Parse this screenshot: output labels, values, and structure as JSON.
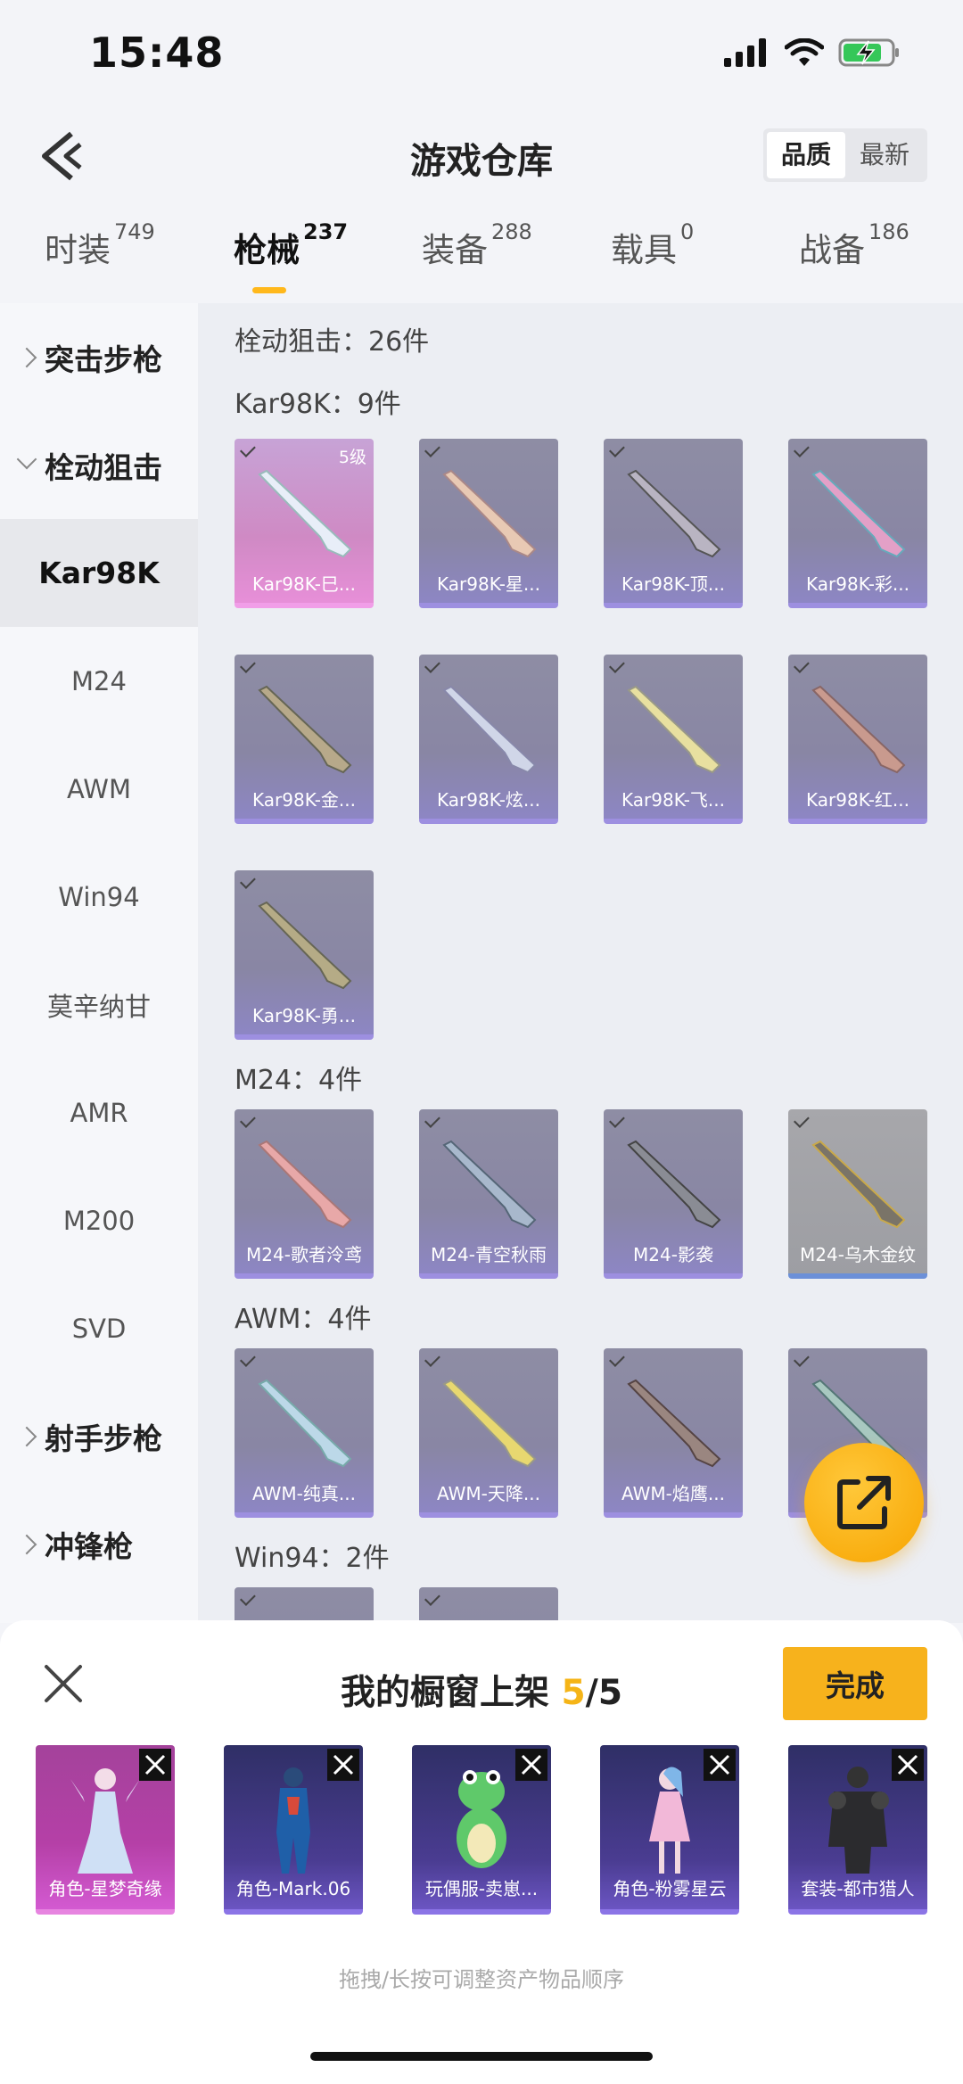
{
  "status_bar": {
    "time": "15:48"
  },
  "header": {
    "title": "游戏仓库",
    "sort_options": [
      "品质",
      "最新"
    ],
    "sort_selected": "品质"
  },
  "tabs": [
    {
      "label": "时装",
      "count": "749"
    },
    {
      "label": "枪械",
      "count": "237",
      "active": true
    },
    {
      "label": "装备",
      "count": "288"
    },
    {
      "label": "载具",
      "count": "0"
    },
    {
      "label": "战备",
      "count": "186"
    }
  ],
  "sidebar": [
    {
      "label": "突击步枪",
      "type": "group",
      "expanded": false
    },
    {
      "label": "栓动狙击",
      "type": "group",
      "expanded": true
    },
    {
      "label": "Kar98K",
      "type": "item",
      "active": true
    },
    {
      "label": "M24",
      "type": "item"
    },
    {
      "label": "AWM",
      "type": "item"
    },
    {
      "label": "Win94",
      "type": "item"
    },
    {
      "label": "莫辛纳甘",
      "type": "item"
    },
    {
      "label": "AMR",
      "type": "item"
    },
    {
      "label": "M200",
      "type": "item"
    },
    {
      "label": "SVD",
      "type": "item"
    },
    {
      "label": "射手步枪",
      "type": "group",
      "expanded": false
    },
    {
      "label": "冲锋枪",
      "type": "group",
      "expanded": false
    }
  ],
  "content": {
    "category_summary": "栓动狙击：26件",
    "sections": [
      {
        "title": "Kar98K：9件",
        "items": [
          {
            "label": "Kar98K-巳...",
            "level": "5级",
            "rarity": "pink",
            "checked": true
          },
          {
            "label": "Kar98K-星...",
            "checked": true
          },
          {
            "label": "Kar98K-顶...",
            "checked": true
          },
          {
            "label": "Kar98K-彩...",
            "checked": true
          },
          {
            "label": "Kar98K-金...",
            "checked": true
          },
          {
            "label": "Kar98K-炫...",
            "checked": true
          },
          {
            "label": "Kar98K-飞...",
            "checked": true
          },
          {
            "label": "Kar98K-红...",
            "checked": true
          },
          {
            "label": "Kar98K-勇...",
            "checked": true
          }
        ]
      },
      {
        "title": "M24：4件",
        "items": [
          {
            "label": "M24-歌者泠鸢",
            "checked": true
          },
          {
            "label": "M24-青空秋雨",
            "checked": true
          },
          {
            "label": "M24-影袭",
            "checked": true
          },
          {
            "label": "M24-乌木金纹",
            "rarity": "grey",
            "checked": true
          }
        ]
      },
      {
        "title": "AWM：4件",
        "items": [
          {
            "label": "AWM-纯真...",
            "checked": true
          },
          {
            "label": "AWM-天降...",
            "checked": true
          },
          {
            "label": "AWM-焰鹰...",
            "checked": true
          },
          {
            "label": "",
            "checked": true
          }
        ]
      },
      {
        "title": "Win94：2件",
        "items": []
      }
    ]
  },
  "showcase": {
    "title_prefix": "我的橱窗上架",
    "count_current": "5",
    "count_total": "/5",
    "done_label": "完成",
    "items": [
      {
        "label": "角色-星梦奇缘",
        "rarity": "pink"
      },
      {
        "label": "角色-Mark.06"
      },
      {
        "label": "玩偶服-卖崽..."
      },
      {
        "label": "角色-粉雾星云"
      },
      {
        "label": "套装-都市猎人"
      }
    ],
    "hint": "拖拽/长按可调整资产物品顺序"
  },
  "colors": {
    "accent": "#f7b21c",
    "tab_underline": "#ffb81c",
    "card_purple": "#8d86c4",
    "card_pink": "#e78fd8"
  }
}
